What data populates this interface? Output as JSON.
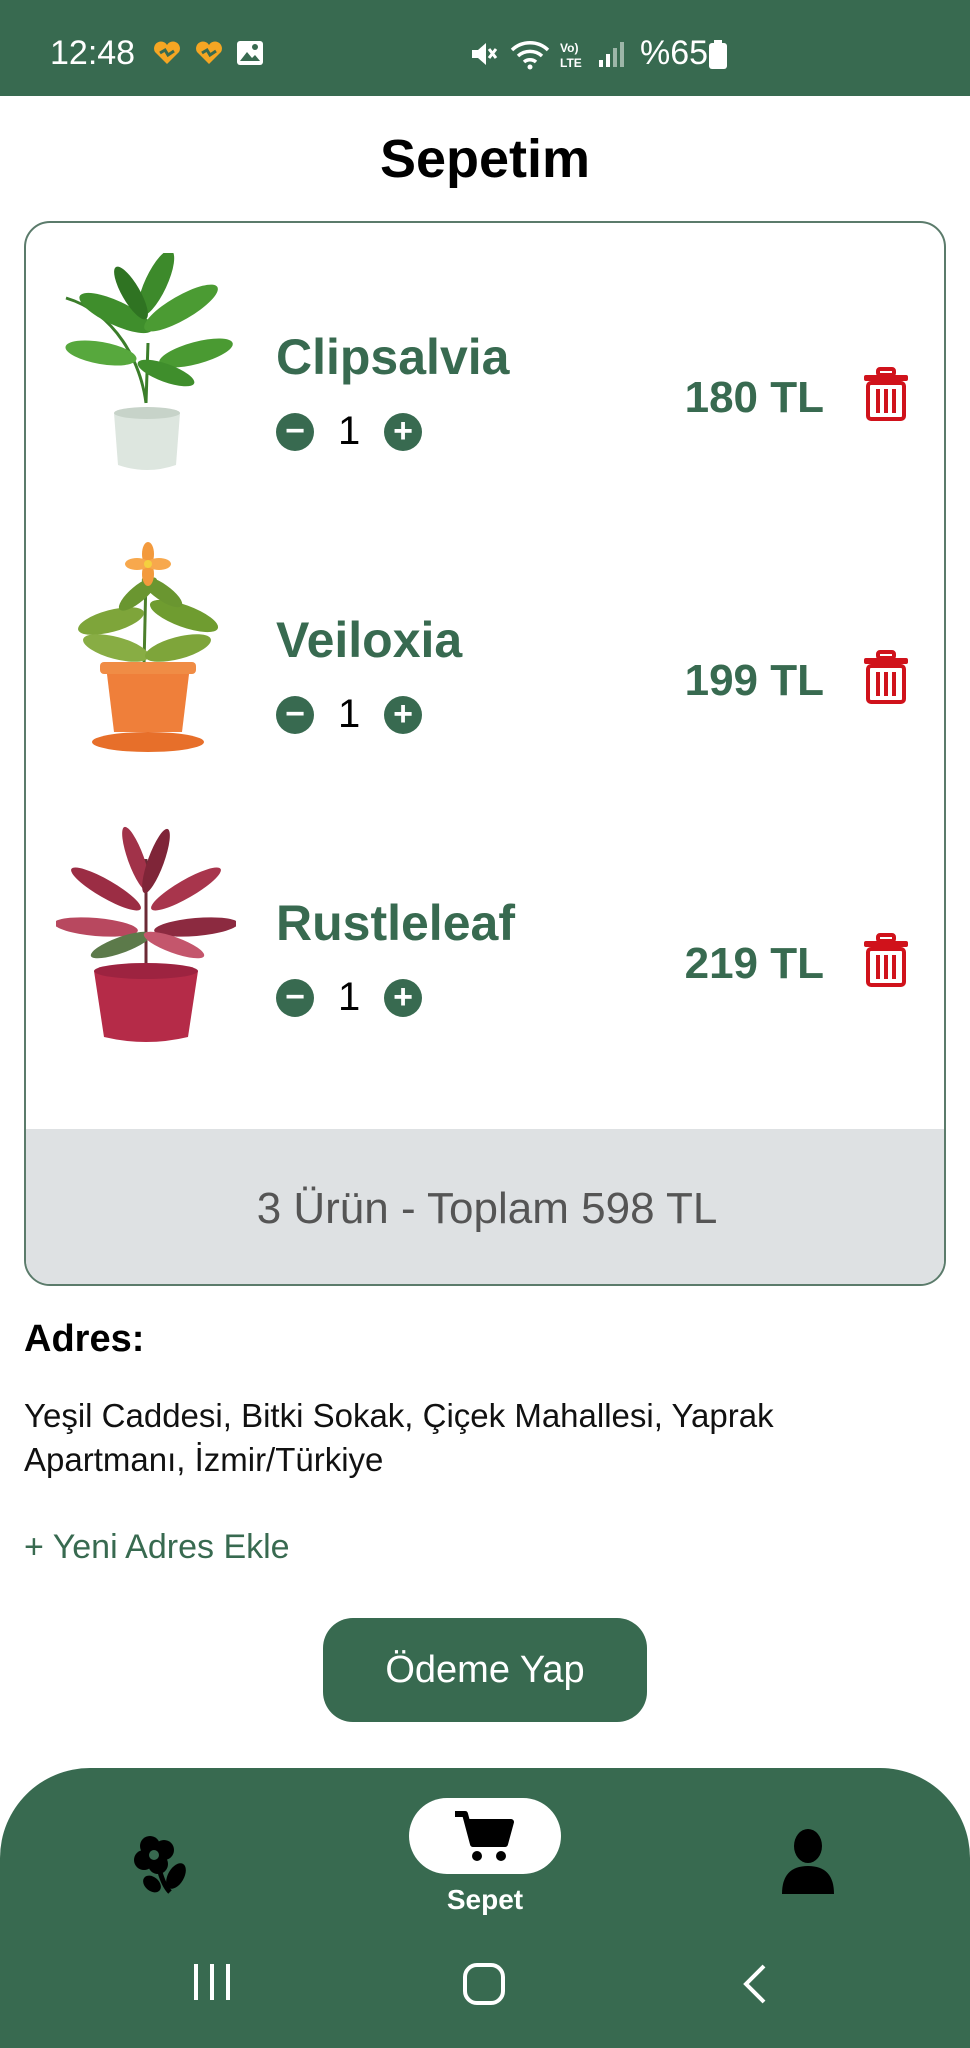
{
  "status_bar": {
    "time": "12:48",
    "battery_text": "%65",
    "icons": [
      "heart-app-icon",
      "heart-app-icon",
      "gallery-icon",
      "mute-icon",
      "wifi-icon",
      "volte-icon",
      "signal-icon",
      "battery-icon"
    ]
  },
  "page": {
    "title": "Sepetim"
  },
  "cart": {
    "items": [
      {
        "name": "Clipsalvia",
        "quantity": "1",
        "price": "180 TL"
      },
      {
        "name": "Veiloxia",
        "quantity": "1",
        "price": "199 TL"
      },
      {
        "name": "Rustleleaf",
        "quantity": "1",
        "price": "219 TL"
      }
    ],
    "summary": "3 Ürün  -  Toplam 598 TL"
  },
  "address": {
    "label": "Adres:",
    "text": "Yeşil Caddesi, Bitki Sokak, Çiçek Mahallesi, Yaprak Apartmanı, İzmir/Türkiye",
    "add_new": "+ Yeni Adres Ekle"
  },
  "checkout": {
    "button_label": "Ödeme Yap"
  },
  "bottom_nav": {
    "items": [
      {
        "icon": "flower-icon",
        "label": ""
      },
      {
        "icon": "cart-icon",
        "label": "Sepet",
        "active": true
      },
      {
        "icon": "profile-icon",
        "label": ""
      }
    ]
  },
  "colors": {
    "primary": "#386a50",
    "danger": "#d0121b",
    "summary_bg": "#dee1e3"
  }
}
